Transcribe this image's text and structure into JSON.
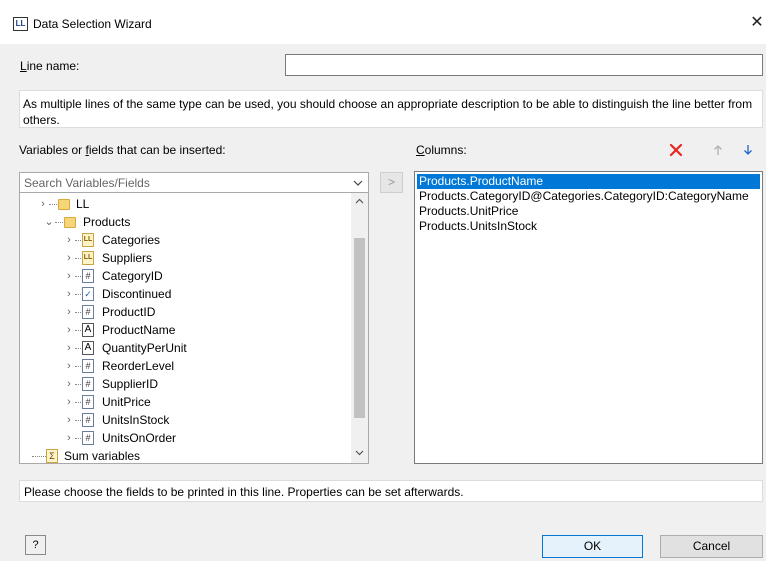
{
  "window": {
    "title": "Data Selection Wizard",
    "app_icon_text": "LL",
    "close_glyph": "✕"
  },
  "line_name": {
    "label_accel": "L",
    "label_rest": "ine name:",
    "value": ""
  },
  "description": "As multiple lines of the same type can be used, you should choose an appropriate description to be able to distinguish the line better from others.",
  "variables": {
    "label_before": "Variables or ",
    "label_accel": "f",
    "label_after": "ields that can be inserted:",
    "search_placeholder": "Search Variables/Fields",
    "tree": [
      {
        "label": "LL",
        "icon": "folder-icon"
      },
      {
        "label": "Products",
        "icon": "folder-icon"
      },
      {
        "label": "Categories",
        "icon": "table-icon"
      },
      {
        "label": "Suppliers",
        "icon": "table-icon"
      },
      {
        "label": "CategoryID",
        "icon": "numeric-field-icon"
      },
      {
        "label": "Discontinued",
        "icon": "boolean-field-icon"
      },
      {
        "label": "ProductID",
        "icon": "numeric-field-icon"
      },
      {
        "label": "ProductName",
        "icon": "text-field-icon"
      },
      {
        "label": "QuantityPerUnit",
        "icon": "text-field-icon"
      },
      {
        "label": "ReorderLevel",
        "icon": "numeric-field-icon"
      },
      {
        "label": "SupplierID",
        "icon": "numeric-field-icon"
      },
      {
        "label": "UnitPrice",
        "icon": "numeric-field-icon"
      },
      {
        "label": "UnitsInStock",
        "icon": "numeric-field-icon"
      },
      {
        "label": "UnitsOnOrder",
        "icon": "numeric-field-icon"
      },
      {
        "label": "Sum variables",
        "icon": "sum-variables-icon"
      }
    ]
  },
  "move_button_label": ">",
  "columns": {
    "label_accel": "C",
    "label_rest": "olumns:",
    "items": [
      "Products.ProductName",
      "Products.CategoryID@Categories.CategoryID:CategoryName",
      "Products.UnitPrice",
      "Products.UnitsInStock"
    ],
    "selected_index": 0
  },
  "hint": "Please choose the fields to be printed in this line. Properties can be set afterwards.",
  "buttons": {
    "help_glyph": "?",
    "ok": "OK",
    "cancel": "Cancel"
  },
  "icon_glyphs": {
    "table": "LL",
    "numeric": "#",
    "boolean": "✓",
    "text": "A",
    "sum": "Σ"
  },
  "colors": {
    "accent": "#0078d7",
    "delete": "#e8261f"
  }
}
